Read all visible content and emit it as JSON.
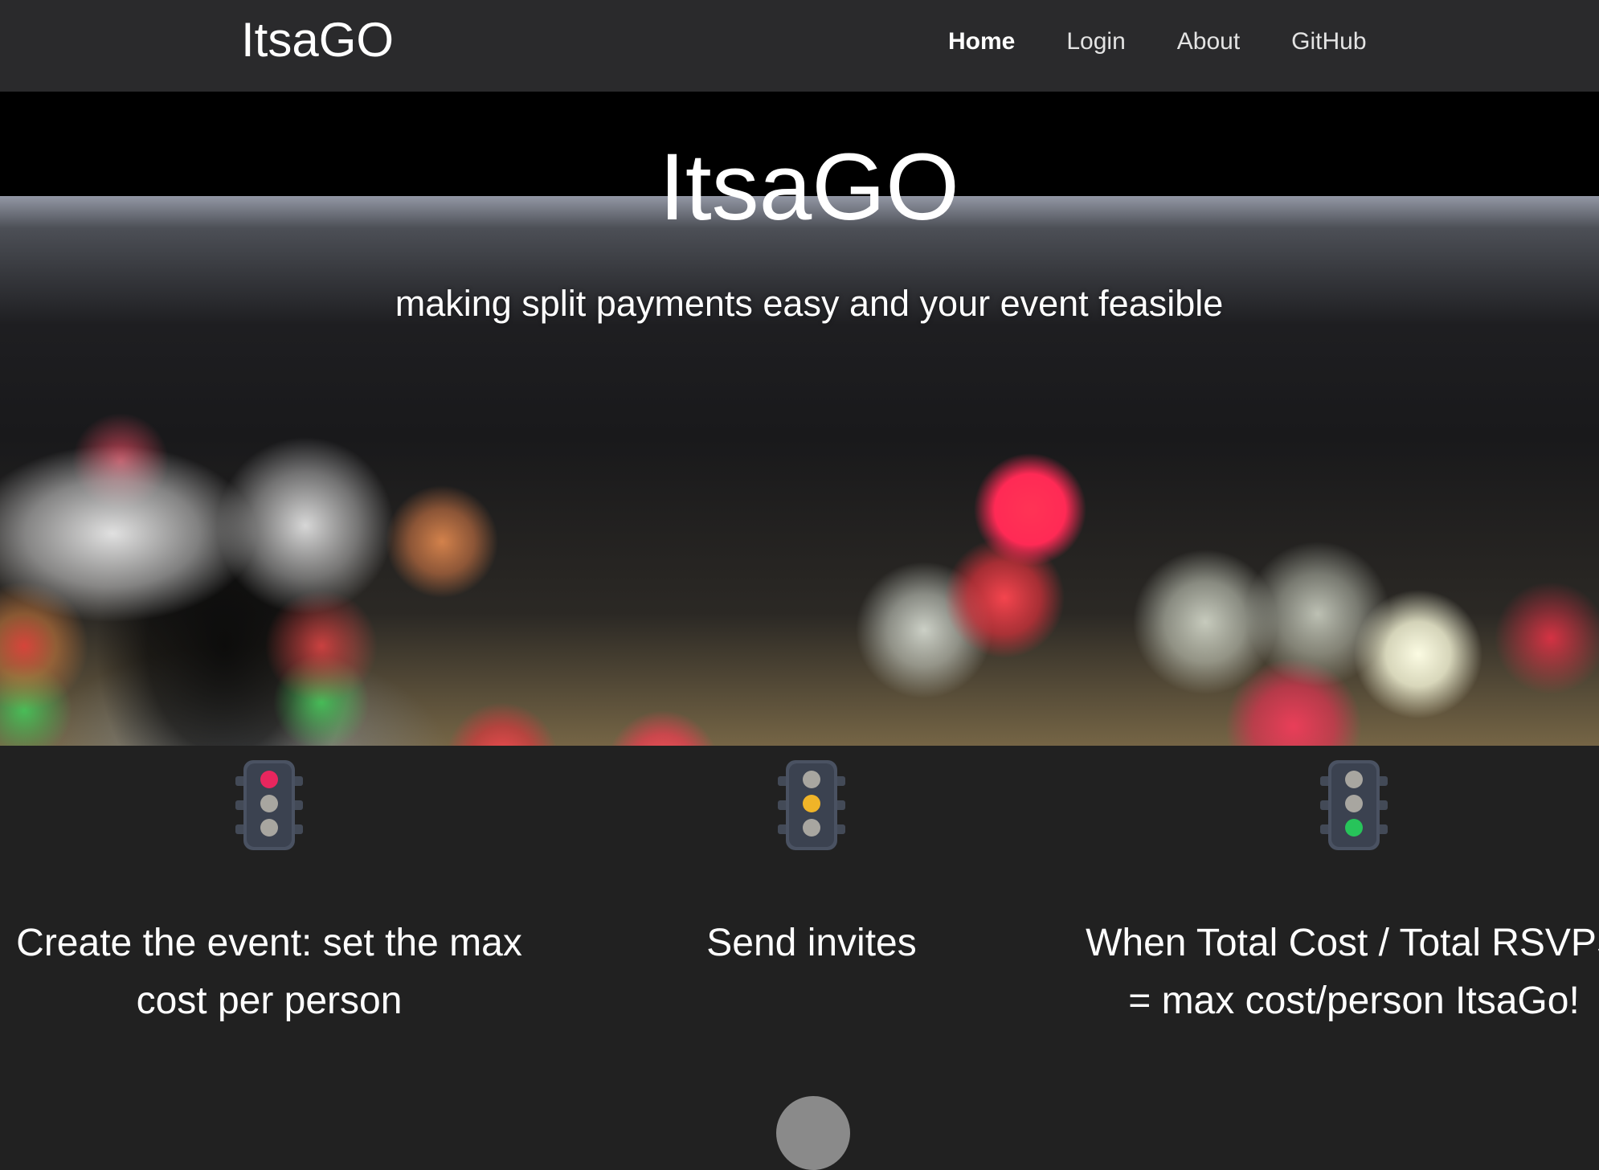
{
  "navbar": {
    "brand": "ItsaGO",
    "links": [
      {
        "label": "Home",
        "active": true
      },
      {
        "label": "Login",
        "active": false
      },
      {
        "label": "About",
        "active": false
      },
      {
        "label": "GitHub",
        "active": false
      }
    ]
  },
  "hero": {
    "title": "ItsaGO",
    "subtitle": "making split payments easy and your event feasible"
  },
  "features": [
    {
      "icon": "traffic-light-red-icon",
      "light": "red",
      "text": "Create the event: set the max cost per person"
    },
    {
      "icon": "traffic-light-yellow-icon",
      "light": "yellow",
      "text": "Send invites"
    },
    {
      "icon": "traffic-light-green-icon",
      "light": "green",
      "text": "When Total Cost / Total RSVPS = max cost/person ItsaGo!"
    }
  ],
  "colors": {
    "navbar_bg": "#2a2a2c",
    "page_bg": "#212121",
    "light_red": "#e8265e",
    "light_yellow": "#f0b428",
    "light_green": "#27c45a",
    "light_off": "#a8a6a0"
  }
}
